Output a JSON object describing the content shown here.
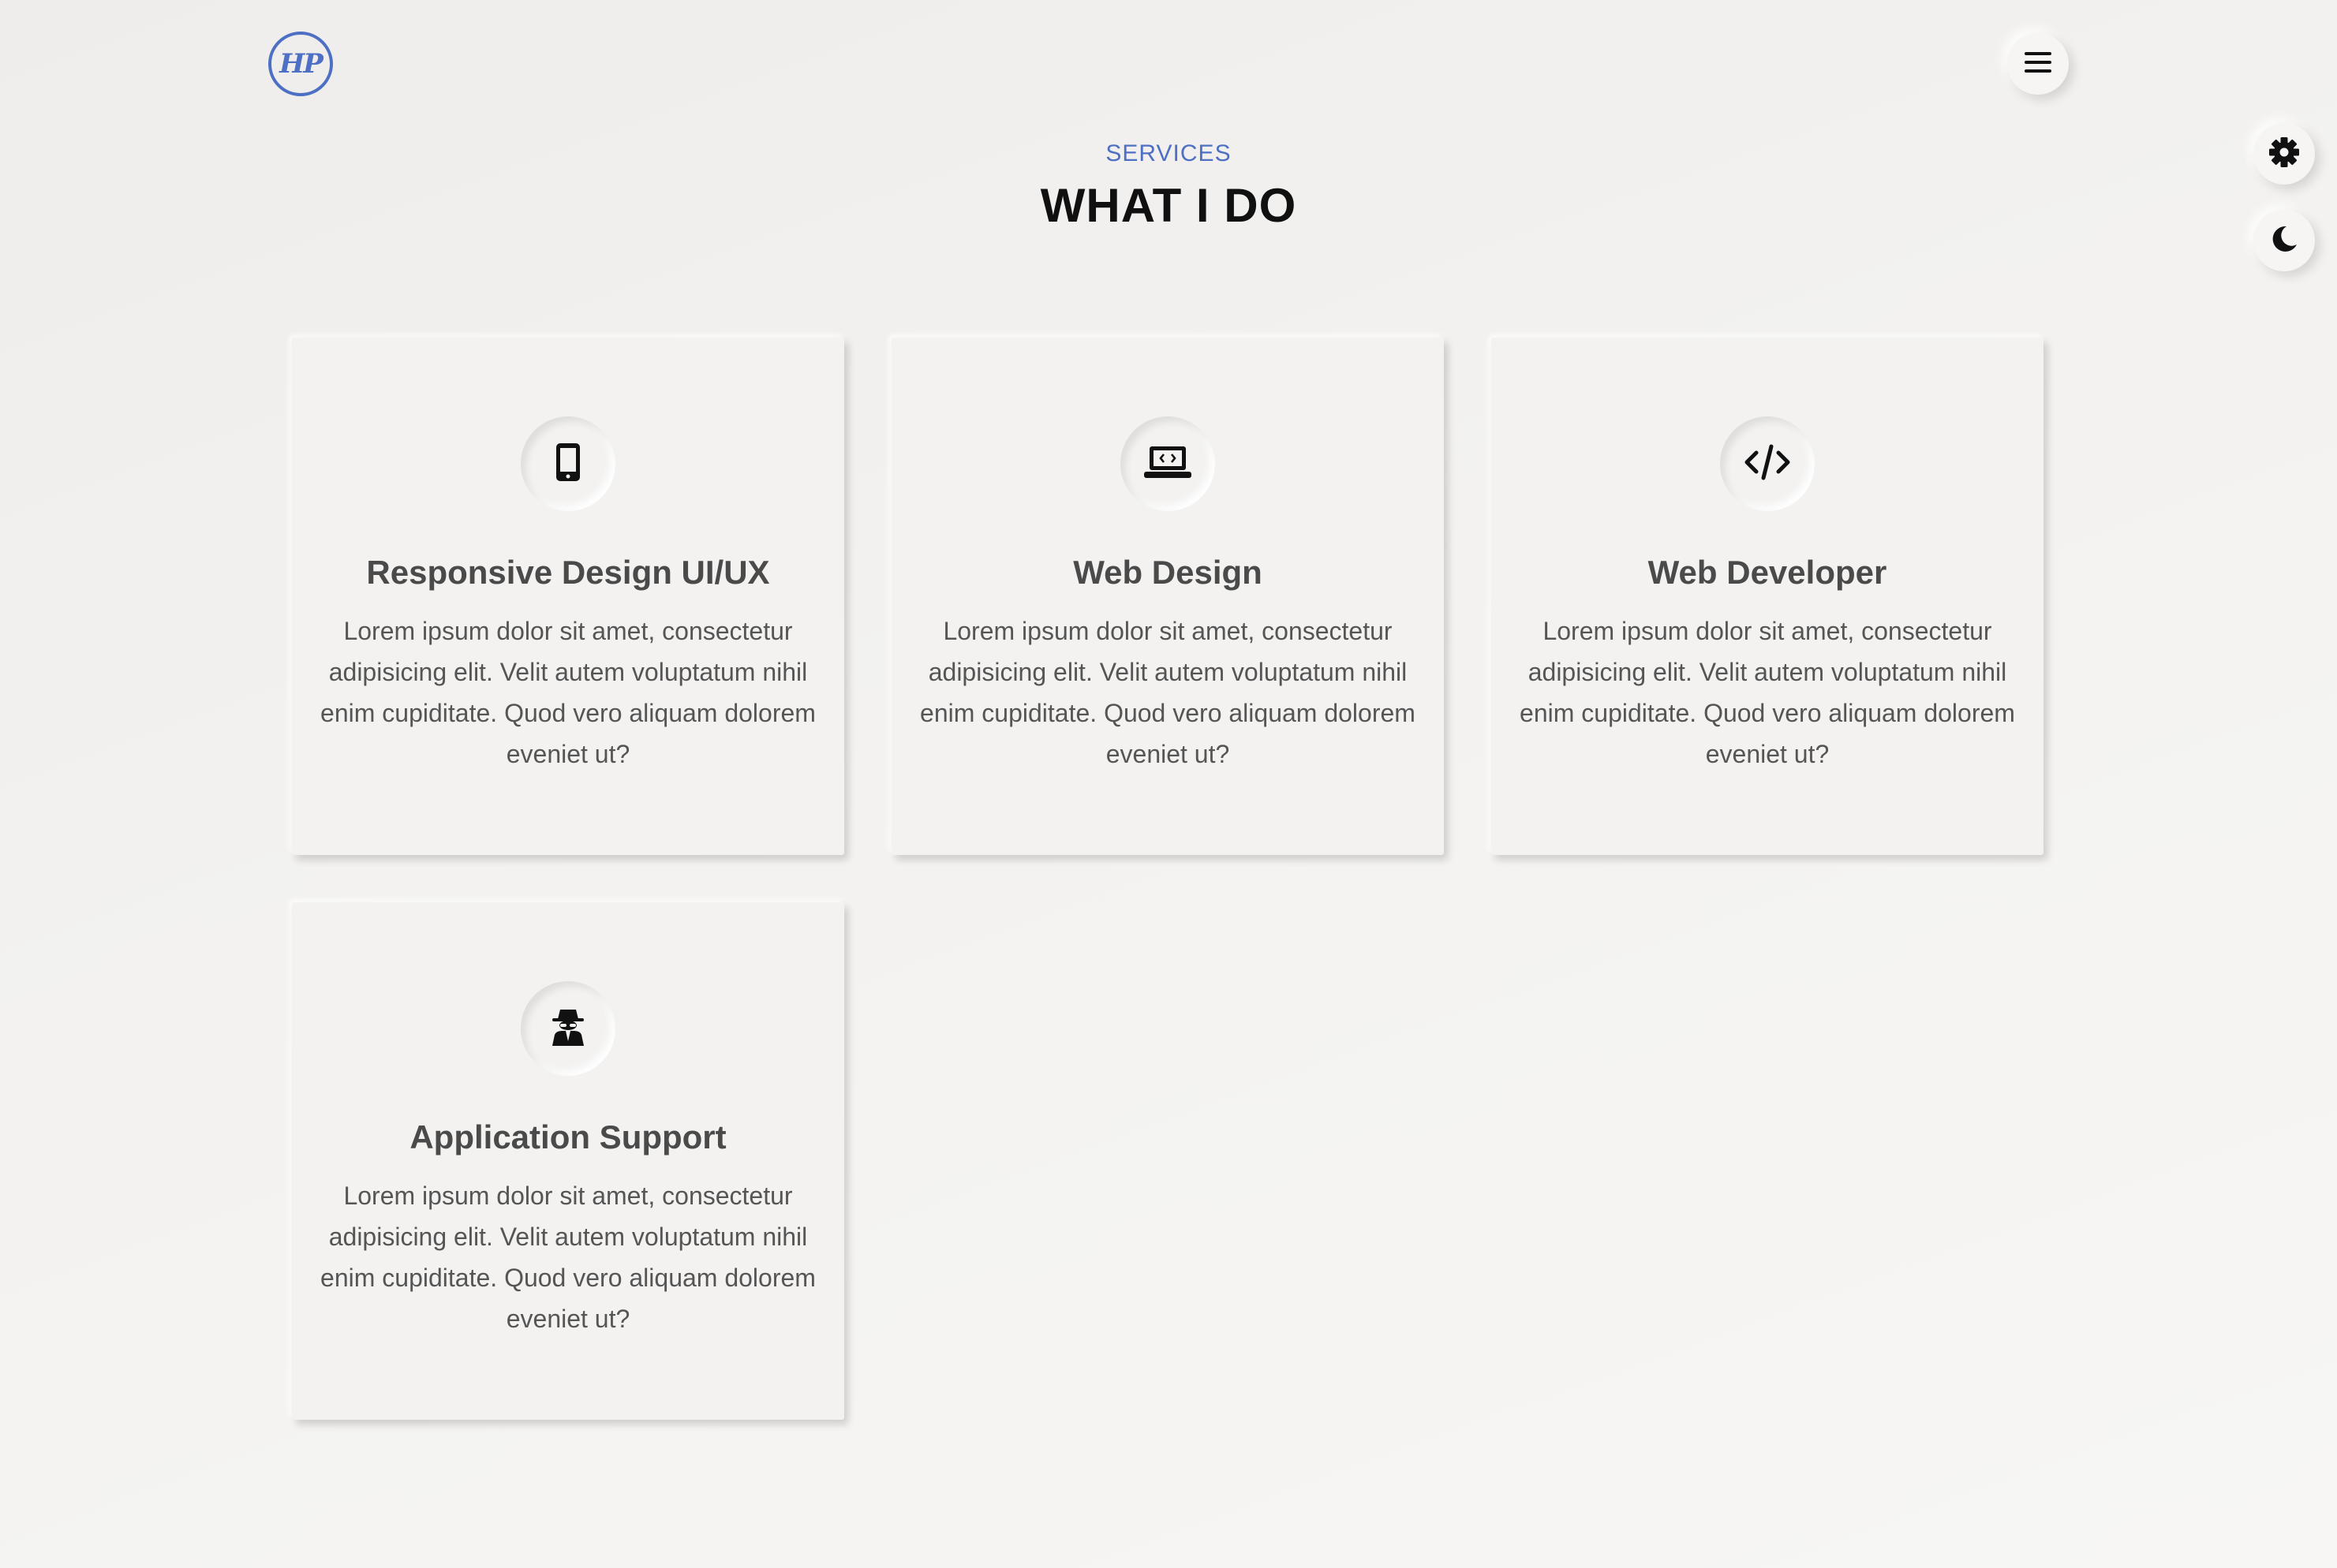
{
  "header": {
    "logo_text": "HP"
  },
  "section": {
    "subtitle": "SERVICES",
    "title": "WHAT I DO"
  },
  "icons": {
    "menu": "hamburger-menu-icon",
    "settings": "gear-icon",
    "theme": "moon-icon"
  },
  "services": [
    {
      "title": "Responsive Design UI/UX",
      "text": "Lorem ipsum dolor sit amet, consectetur adipisicing elit. Velit autem voluptatum nihil enim cupiditate. Quod vero aliquam dolorem eveniet ut?",
      "icon": "mobile-phone-icon"
    },
    {
      "title": "Web Design",
      "text": "Lorem ipsum dolor sit amet, consectetur adipisicing elit. Velit autem voluptatum nihil enim cupiditate. Quod vero aliquam dolorem eveniet ut?",
      "icon": "laptop-code-icon"
    },
    {
      "title": "Web Developer",
      "text": "Lorem ipsum dolor sit amet, consectetur adipisicing elit. Velit autem voluptatum nihil enim cupiditate. Quod vero aliquam dolorem eveniet ut?",
      "icon": "code-icon"
    },
    {
      "title": "Application Support",
      "text": "Lorem ipsum dolor sit amet, consectetur adipisicing elit. Velit autem voluptatum nihil enim cupiditate. Quod vero aliquam dolorem eveniet ut?",
      "icon": "user-secret-icon"
    }
  ],
  "colors": {
    "accent": "#4d6fc4",
    "heading": "#101010",
    "text": "#555555",
    "background": "#f3f2f0"
  }
}
